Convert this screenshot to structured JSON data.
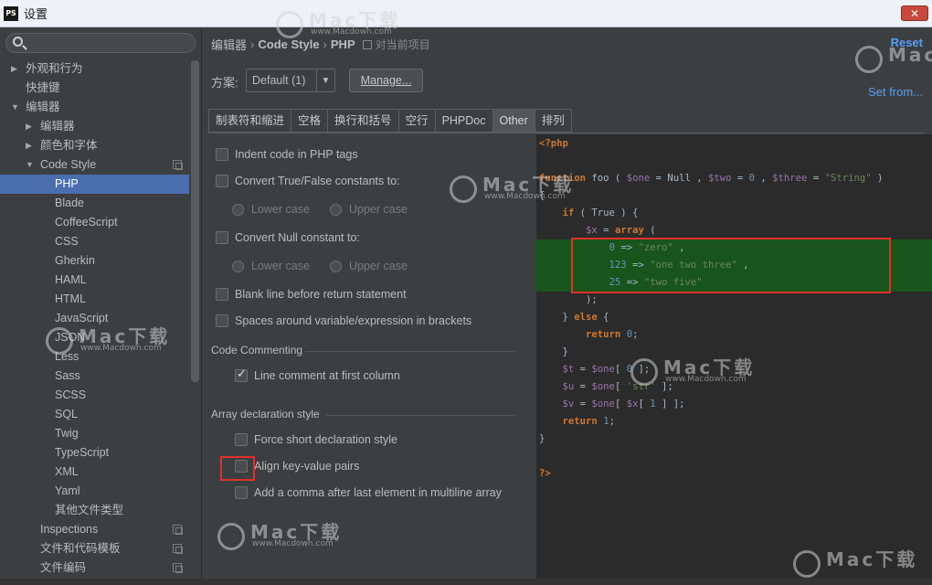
{
  "window": {
    "title": "设置",
    "app_icon_text": "PS",
    "close_label": "✕"
  },
  "sidebar": {
    "search_placeholder": "",
    "items": [
      {
        "label": "外观和行为",
        "level": 0,
        "arrow": "▶"
      },
      {
        "label": "快捷键",
        "level": 0,
        "arrow": ""
      },
      {
        "label": "编辑器",
        "level": 0,
        "arrow": "▼"
      },
      {
        "label": "编辑器",
        "level": 1,
        "arrow": "▶"
      },
      {
        "label": "颜色和字体",
        "level": 1,
        "arrow": "▶"
      },
      {
        "label": "Code Style",
        "level": 1,
        "arrow": "▼",
        "copy": true
      },
      {
        "label": "PHP",
        "level": 2,
        "arrow": "",
        "selected": true
      },
      {
        "label": "Blade",
        "level": 2,
        "arrow": ""
      },
      {
        "label": "CoffeeScript",
        "level": 2,
        "arrow": ""
      },
      {
        "label": "CSS",
        "level": 2,
        "arrow": ""
      },
      {
        "label": "Gherkin",
        "level": 2,
        "arrow": ""
      },
      {
        "label": "HAML",
        "level": 2,
        "arrow": ""
      },
      {
        "label": "HTML",
        "level": 2,
        "arrow": ""
      },
      {
        "label": "JavaScript",
        "level": 2,
        "arrow": ""
      },
      {
        "label": "JSON",
        "level": 2,
        "arrow": ""
      },
      {
        "label": "Less",
        "level": 2,
        "arrow": ""
      },
      {
        "label": "Sass",
        "level": 2,
        "arrow": ""
      },
      {
        "label": "SCSS",
        "level": 2,
        "arrow": ""
      },
      {
        "label": "SQL",
        "level": 2,
        "arrow": ""
      },
      {
        "label": "Twig",
        "level": 2,
        "arrow": ""
      },
      {
        "label": "TypeScript",
        "level": 2,
        "arrow": ""
      },
      {
        "label": "XML",
        "level": 2,
        "arrow": ""
      },
      {
        "label": "Yaml",
        "level": 2,
        "arrow": ""
      },
      {
        "label": "其他文件类型",
        "level": 2,
        "arrow": ""
      },
      {
        "label": "Inspections",
        "level": 1,
        "arrow": "",
        "copy": true
      },
      {
        "label": "文件和代码模板",
        "level": 1,
        "arrow": "",
        "copy": true
      },
      {
        "label": "文件编码",
        "level": 1,
        "arrow": "",
        "copy": true
      }
    ]
  },
  "header": {
    "crumbs": [
      "编辑器",
      "Code Style",
      "PHP"
    ],
    "project_text": "对当前项目",
    "reset_label": "Reset",
    "set_from_label": "Set from..."
  },
  "scheme": {
    "label": "方案:",
    "value": "Default (1)",
    "manage_label": "Manage..."
  },
  "tabs": [
    {
      "label": "制表符和缩进",
      "active": false
    },
    {
      "label": "空格",
      "active": false
    },
    {
      "label": "换行和括号",
      "active": false
    },
    {
      "label": "空行",
      "active": false
    },
    {
      "label": "PHPDoc",
      "active": false
    },
    {
      "label": "Other",
      "active": true
    },
    {
      "label": "排列",
      "active": false
    }
  ],
  "options": {
    "indent_php_tags": "Indent code in PHP tags",
    "convert_true_false": "Convert True/False constants to:",
    "tf_lower": "Lower case",
    "tf_upper": "Upper case",
    "convert_null": "Convert Null constant to:",
    "null_lower": "Lower case",
    "null_upper": "Upper case",
    "blank_line_return": "Blank line before return statement",
    "spaces_brackets": "Spaces around variable/expression in brackets",
    "code_commenting_title": "Code Commenting",
    "line_comment_first_col": "Line comment at first column",
    "line_comment_checked": true,
    "array_decl_title": "Array declaration style",
    "force_short": "Force short declaration style",
    "align_kv": "Align key-value pairs",
    "add_comma": "Add a comma after last element in multiline array"
  },
  "code_lines": [
    [
      [
        "kw",
        "<?php"
      ]
    ],
    [
      [
        "t",
        ""
      ]
    ],
    [
      [
        "kw",
        "function"
      ],
      [
        "t",
        " foo ( "
      ],
      [
        "var",
        "$one"
      ],
      [
        "t",
        " = Null , "
      ],
      [
        "var",
        "$two"
      ],
      [
        "t",
        " = "
      ],
      [
        "num",
        "0"
      ],
      [
        "t",
        " , "
      ],
      [
        "var",
        "$three"
      ],
      [
        "t",
        " = "
      ],
      [
        "str",
        "\"String\""
      ],
      [
        "t",
        " )"
      ]
    ],
    [
      [
        "t",
        "{"
      ]
    ],
    [
      [
        "t",
        "    "
      ],
      [
        "kw",
        "if"
      ],
      [
        "t",
        " ( True ) {"
      ]
    ],
    [
      [
        "t",
        "        "
      ],
      [
        "var",
        "$x"
      ],
      [
        "t",
        " = "
      ],
      [
        "kw",
        "array"
      ],
      [
        "t",
        " ("
      ]
    ],
    [
      [
        "t",
        "            "
      ],
      [
        "num",
        "0"
      ],
      [
        "t",
        " => "
      ],
      [
        "str",
        "\"zero\""
      ],
      [
        "t",
        " ,"
      ]
    ],
    [
      [
        "t",
        "            "
      ],
      [
        "num",
        "123"
      ],
      [
        "t",
        " => "
      ],
      [
        "str",
        "\"one two three\""
      ],
      [
        "t",
        " ,"
      ]
    ],
    [
      [
        "t",
        "            "
      ],
      [
        "num",
        "25"
      ],
      [
        "t",
        " => "
      ],
      [
        "str",
        "\"two five\""
      ]
    ],
    [
      [
        "t",
        "        );"
      ]
    ],
    [
      [
        "t",
        "    } "
      ],
      [
        "kw",
        "else"
      ],
      [
        "t",
        " {"
      ]
    ],
    [
      [
        "t",
        "        "
      ],
      [
        "kw",
        "return"
      ],
      [
        "t",
        " "
      ],
      [
        "num",
        "0"
      ],
      [
        "t",
        ";"
      ]
    ],
    [
      [
        "t",
        "    }"
      ]
    ],
    [
      [
        "t",
        "    "
      ],
      [
        "var",
        "$t"
      ],
      [
        "t",
        " = "
      ],
      [
        "var",
        "$one"
      ],
      [
        "t",
        "[ "
      ],
      [
        "num",
        "0"
      ],
      [
        "t",
        " ];"
      ]
    ],
    [
      [
        "t",
        "    "
      ],
      [
        "var",
        "$u"
      ],
      [
        "t",
        " = "
      ],
      [
        "var",
        "$one"
      ],
      [
        "t",
        "[ "
      ],
      [
        "str",
        "'str'"
      ],
      [
        "t",
        " ];"
      ]
    ],
    [
      [
        "t",
        "    "
      ],
      [
        "var",
        "$v"
      ],
      [
        "t",
        " = "
      ],
      [
        "var",
        "$one"
      ],
      [
        "t",
        "[ "
      ],
      [
        "var",
        "$x"
      ],
      [
        "t",
        "[ "
      ],
      [
        "num",
        "1"
      ],
      [
        "t",
        " ] ];"
      ]
    ],
    [
      [
        "t",
        "    "
      ],
      [
        "kw",
        "return"
      ],
      [
        "t",
        " "
      ],
      [
        "num",
        "1"
      ],
      [
        "t",
        ";"
      ]
    ],
    [
      [
        "t",
        "}"
      ]
    ],
    [
      [
        "t",
        ""
      ]
    ],
    [
      [
        "kw",
        "?>"
      ]
    ]
  ],
  "highlighted_code_lines": [
    6,
    8
  ],
  "watermark": {
    "main": "Mac下载",
    "sub": "www.Macdown.com"
  }
}
